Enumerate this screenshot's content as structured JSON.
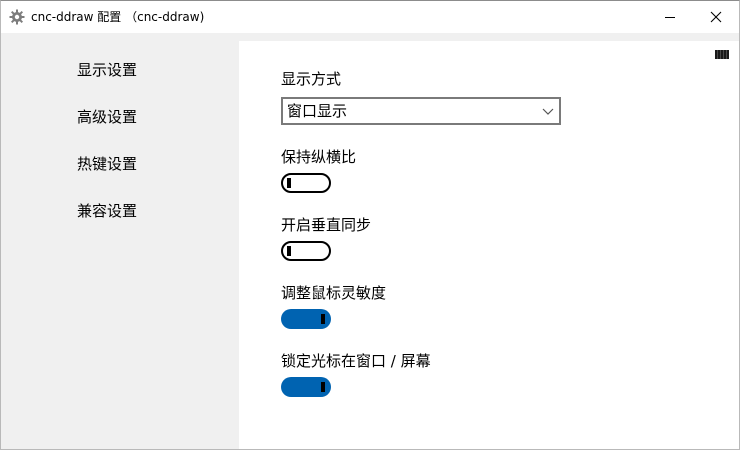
{
  "window": {
    "title": "cnc-ddraw 配置 （cnc-ddraw)"
  },
  "sidebar": {
    "items": [
      {
        "label": "显示设置"
      },
      {
        "label": "高级设置"
      },
      {
        "label": "热键设置"
      },
      {
        "label": "兼容设置"
      }
    ]
  },
  "display": {
    "mode_label": "显示方式",
    "mode_value": "窗口显示",
    "settings": [
      {
        "label": "保持纵横比",
        "enabled": false
      },
      {
        "label": "开启垂直同步",
        "enabled": false
      },
      {
        "label": "调整鼠标灵敏度",
        "enabled": true
      },
      {
        "label": "锁定光标在窗口 / 屏幕",
        "enabled": true
      }
    ]
  },
  "colors": {
    "accent": "#0063b1",
    "sidebar_bg": "#f0f0f0",
    "content_bg": "#ffffff"
  }
}
